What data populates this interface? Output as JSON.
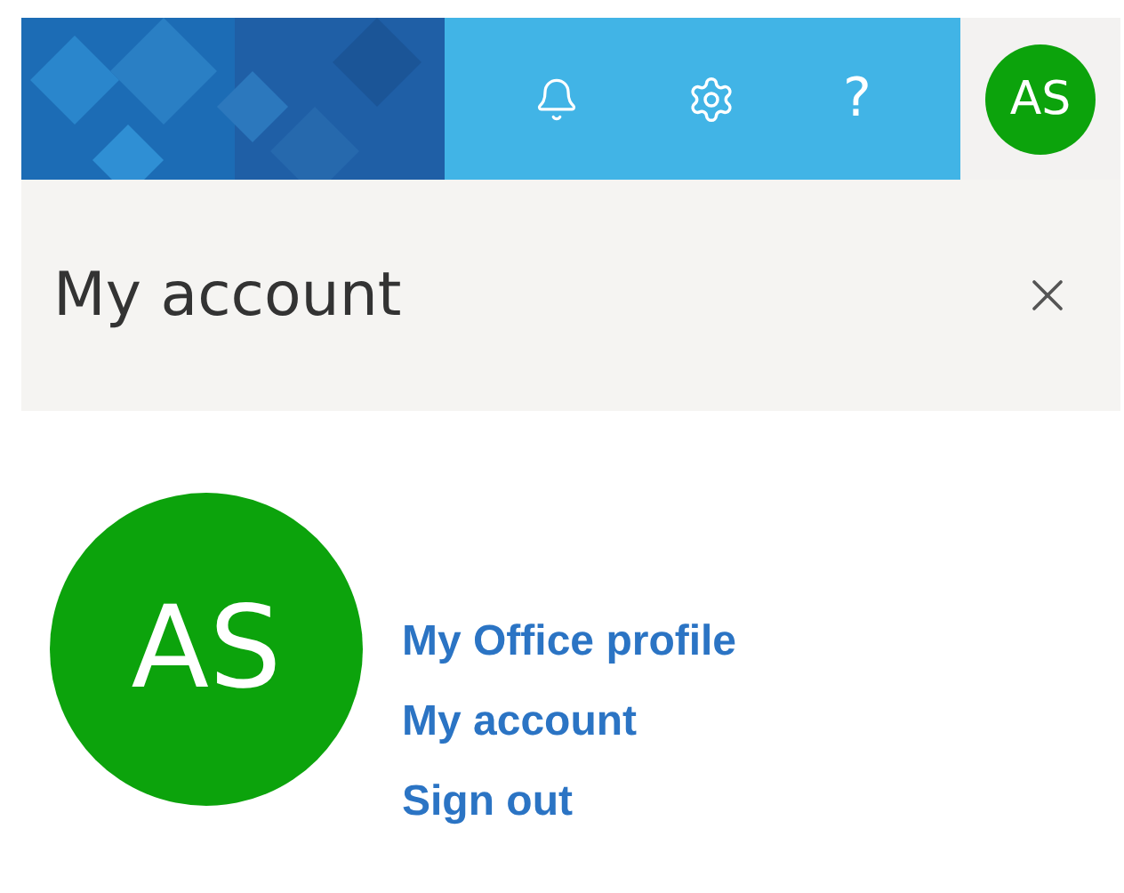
{
  "top_bar": {
    "help_glyph": "?",
    "avatar_initials": "AS"
  },
  "panel": {
    "title": "My account"
  },
  "profile": {
    "initials": "AS",
    "links": [
      "My Office profile",
      "My account",
      "Sign out"
    ]
  }
}
